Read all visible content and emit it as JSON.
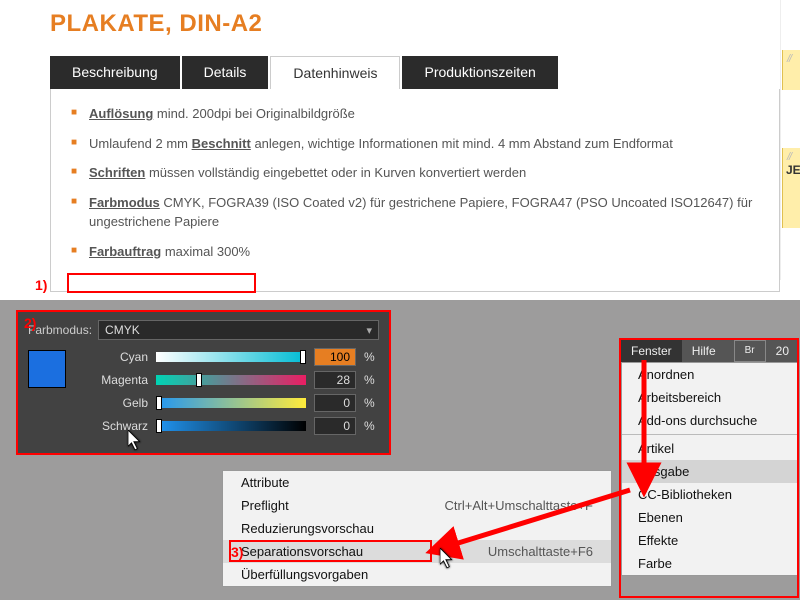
{
  "title": "PLAKATE, DIN-A2",
  "tabs": [
    "Beschreibung",
    "Details",
    "Datenhinweis",
    "Produktionszeiten"
  ],
  "active_tab": 2,
  "bullets": [
    {
      "link": "Auflösung",
      "text": " mind. 200dpi bei Originalbildgröße"
    },
    {
      "pre": "Umlaufend 2 mm ",
      "link": "Beschnitt",
      "text": " anlegen, wichtige Informationen mit mind. 4 mm Abstand zum Endformat"
    },
    {
      "link": "Schriften",
      "text": " müssen vollständig eingebettet oder in Kurven konvertiert werden"
    },
    {
      "link": "Farbmodus",
      "text": " CMYK, FOGRA39 (ISO Coated v2) für gestrichene Papiere, FOGRA47 (PSO Uncoated ISO12647) für ungestrichene Papiere"
    },
    {
      "link": "Farbauftrag",
      "text": " maximal 300%"
    }
  ],
  "ann": {
    "one": "1)",
    "two": "2)",
    "three": "3)"
  },
  "color_panel": {
    "label": "Farbmodus:",
    "mode": "CMYK",
    "sliders": [
      {
        "name": "Cyan",
        "value": "100",
        "pos": 100,
        "cls": "cyan",
        "hl": true
      },
      {
        "name": "Magenta",
        "value": "28",
        "pos": 28,
        "cls": "mag"
      },
      {
        "name": "Gelb",
        "value": "0",
        "pos": 0,
        "cls": "gelb"
      },
      {
        "name": "Schwarz",
        "value": "0",
        "pos": 0,
        "cls": "schw"
      }
    ],
    "pct": "%"
  },
  "submenu": {
    "items": [
      {
        "label": "Attribute",
        "short": ""
      },
      {
        "label": "Preflight",
        "short": "Ctrl+Alt+Umschalttaste+F"
      },
      {
        "label": "Reduzierungsvorschau",
        "short": ""
      },
      {
        "label": "Separationsvorschau",
        "short": "Umschalttaste+F6",
        "sel": true
      },
      {
        "label": "Überfüllungsvorgaben",
        "short": ""
      }
    ]
  },
  "topmenu": {
    "bar": [
      "Fenster",
      "Hilfe"
    ],
    "br": "Br",
    "right": "20",
    "items": [
      "Anordnen",
      "Arbeitsbereich",
      "Add-ons durchsuche",
      "-",
      "Artikel",
      "Ausgabe",
      "CC-Bibliotheken",
      "Ebenen",
      "Effekte",
      "Farbe"
    ]
  },
  "side": {
    "label": "JE",
    "slash": "//"
  }
}
